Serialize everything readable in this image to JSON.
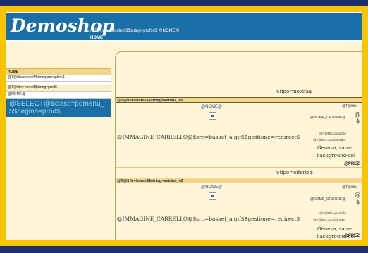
{
  "header": {
    "logo": "Demoshop",
    "tag": "@T@title=prodinfo$$string=profilo$ @NOME@",
    "home": "HOME"
  },
  "left": {
    "heading": "HOME",
    "rows": [
      "@T@title=home$$string=reception$",
      "@T@title=home$$string=prod$",
      "@NOME@"
    ],
    "sql": "@SELECT@$class=pdmenu_ $$pagina=prod$"
  },
  "sections": [
    {
      "tipo": "$tipo=novità$",
      "bar": "@T@title=home$$string=vetrina_n$",
      "nome": "@NOME@",
      "t_right": "@T@title",
      "nome_opzione": "@NOME_OPZIONE@",
      "at": "@",
      "dollar": "$",
      "cart": "@IMMAGINE_CARRELLO@$src=basket_a.gif$$gestione=redirect$",
      "small1": "@T@title=prodinfo",
      "small2": "@T@title=prodinfo$$st",
      "geneva": [
        "Geneva, sans-",
        "background-col"
      ],
      "prez": "@PREZ"
    },
    {
      "tipo": "$tipo=offerta$",
      "bar": "@T@title=home$$string=vetrina_o$",
      "nome": "@NOME@",
      "t_right": "@T@title",
      "nome_opzione": "@NOME_OPZIONE@",
      "at": "@",
      "dollar": "$",
      "cart": "@IMMAGINE_CARRELLO@$src=basket_a.gif$$gestione=redirect$",
      "small1": "@T@title=prodinfo",
      "small2": "@T@title=prodinfo$$st",
      "geneva": [
        "Geneva, sans-",
        "background-col"
      ],
      "prez": "@PREZ"
    }
  ],
  "colors": {
    "page_border": "#f6c400",
    "navy_bar": "#1f2f6b",
    "header_blue": "#1a6fa6",
    "cream": "#fdf4d4"
  }
}
